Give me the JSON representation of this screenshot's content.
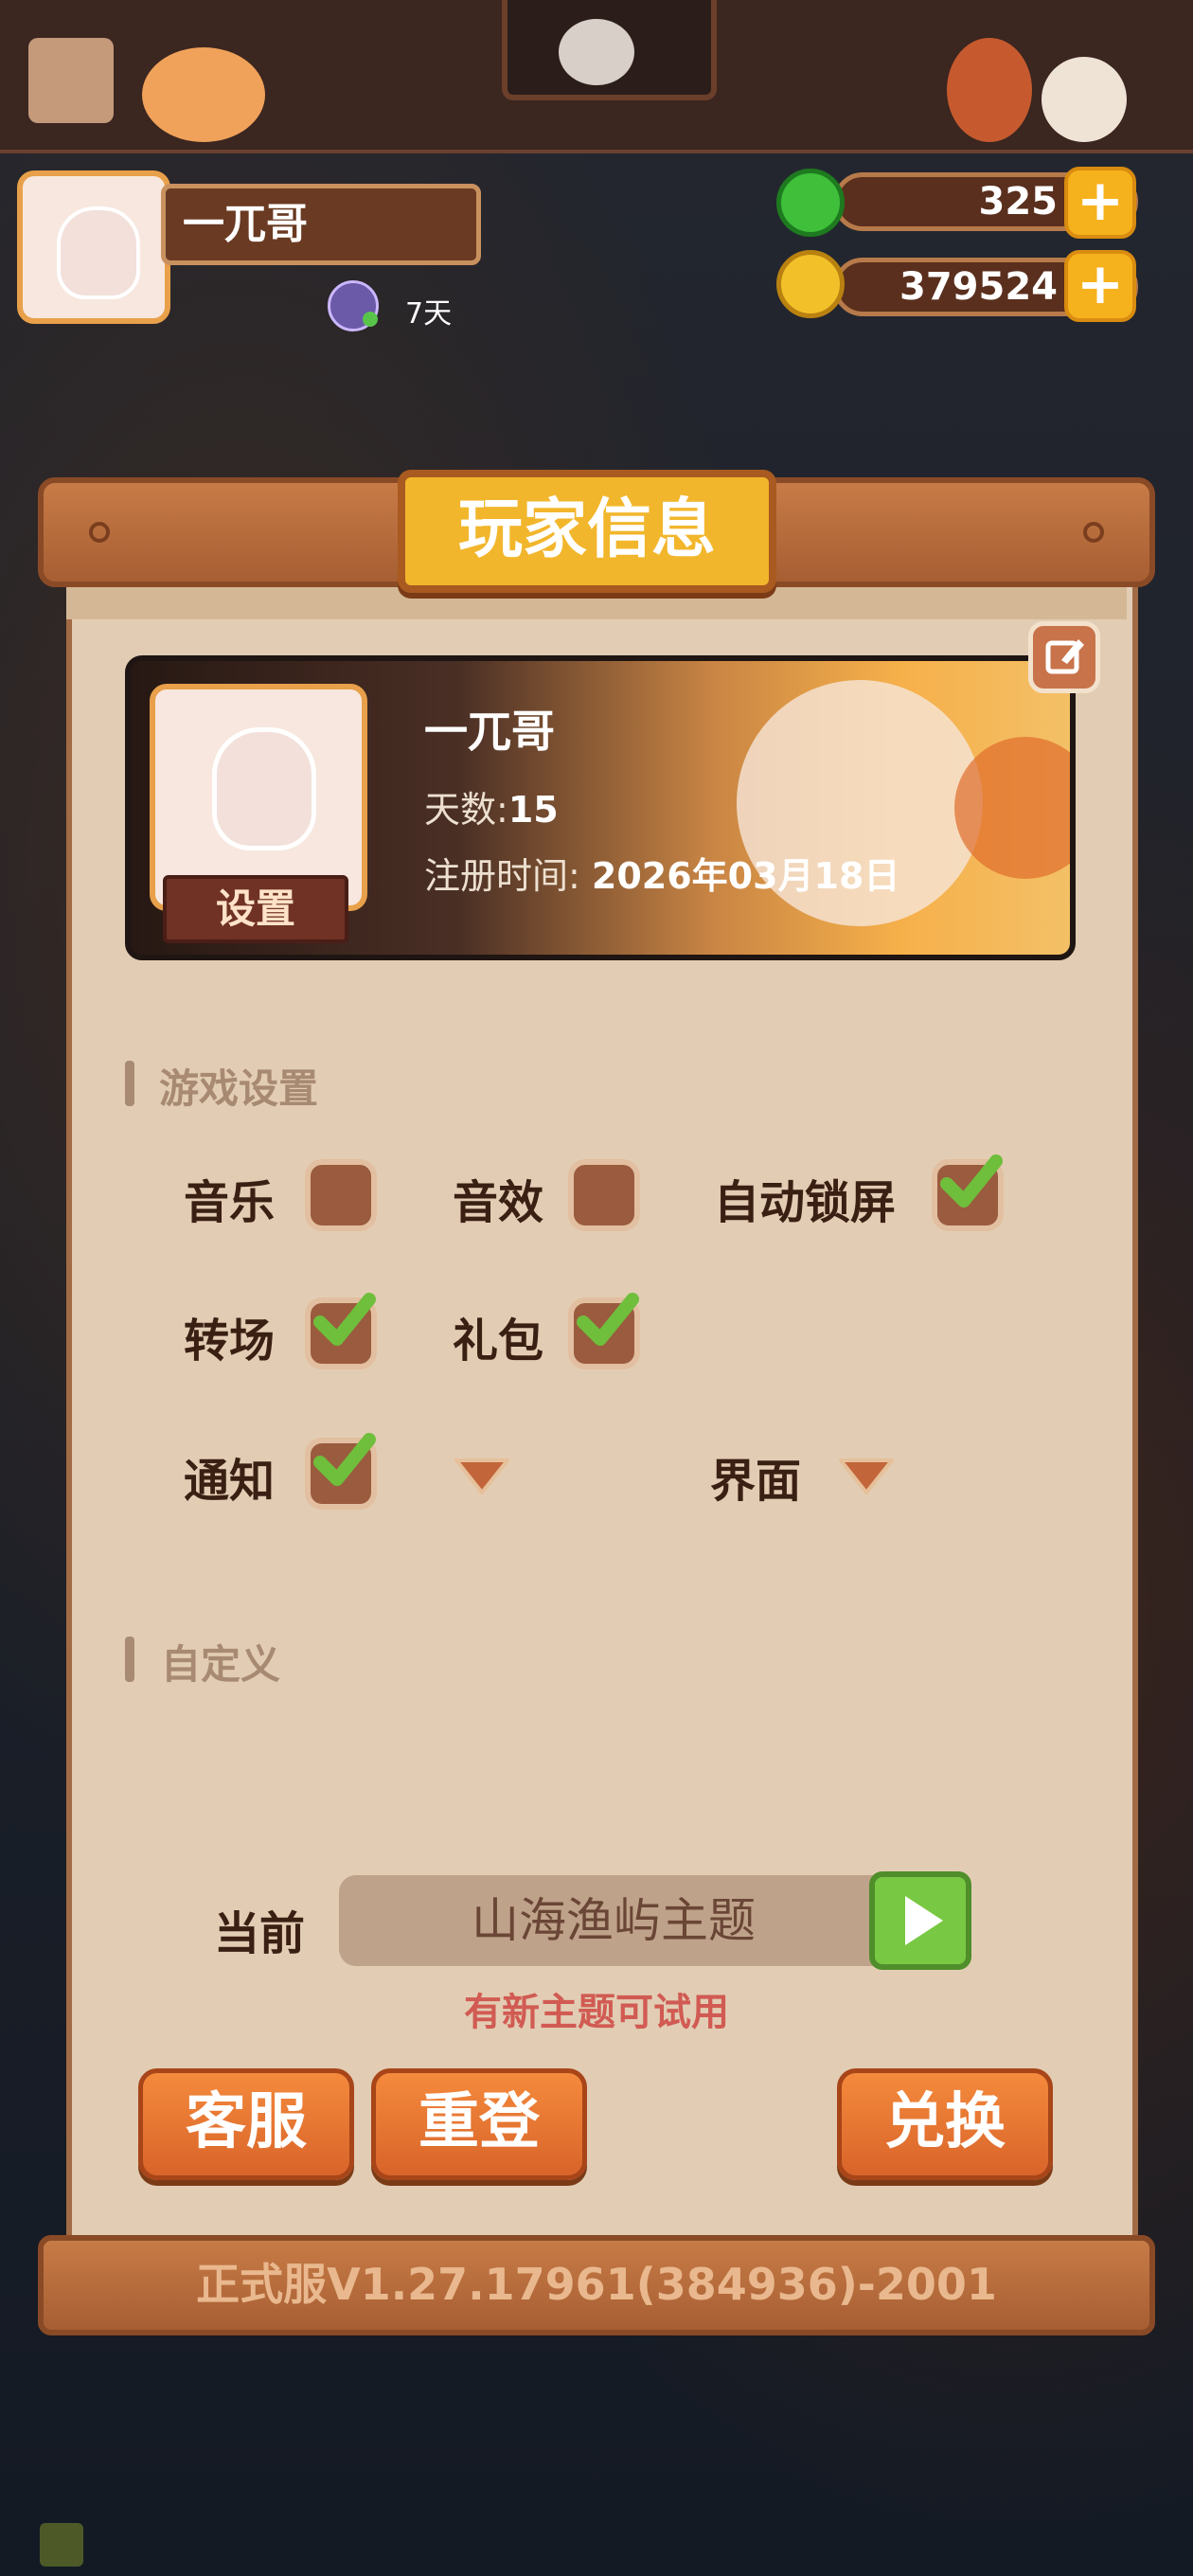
{
  "player": {
    "name": "一兀哥",
    "days_badge": "7天"
  },
  "currency": {
    "gems": "325",
    "coins": "379524"
  },
  "panel": {
    "title": "玩家信息",
    "card": {
      "name": "一兀哥",
      "days_label": "天数:",
      "days_value": "15",
      "register_label": "注册时间:",
      "register_value": "2026年03月18日",
      "settings_button": "设置"
    },
    "game_settings": {
      "heading": "游戏设置",
      "options": [
        {
          "label": "音乐",
          "checked": false
        },
        {
          "label": "音效",
          "checked": false
        },
        {
          "label": "自动锁屏",
          "checked": true
        },
        {
          "label": "转场",
          "checked": true
        },
        {
          "label": "礼包",
          "checked": true
        },
        {
          "label": "通知",
          "checked": true
        }
      ],
      "dropdown_empty_label": "",
      "interface_label": "界面"
    },
    "custom": {
      "heading": "自定义",
      "current_label": "当前",
      "theme_value": "山海渔屿主题",
      "hint": "有新主题可试用"
    },
    "buttons": {
      "service": "客服",
      "relogin": "重登",
      "redeem": "兑换"
    },
    "version": "正式服V1.27.17961(384936)-2001"
  },
  "colors": {
    "panel_bg": "#e2cdb4",
    "wood": "#c77b46",
    "title_gold": "#f2b62c",
    "check_green": "#79c843",
    "hint_red": "#d15b53",
    "button_orange": "#f48a3c"
  },
  "icons": [
    "plus-icon",
    "edit-icon",
    "check-icon",
    "play-icon",
    "chevron-down-icon",
    "jade-gem-icon",
    "gold-coin-icon",
    "vip-icon"
  ]
}
